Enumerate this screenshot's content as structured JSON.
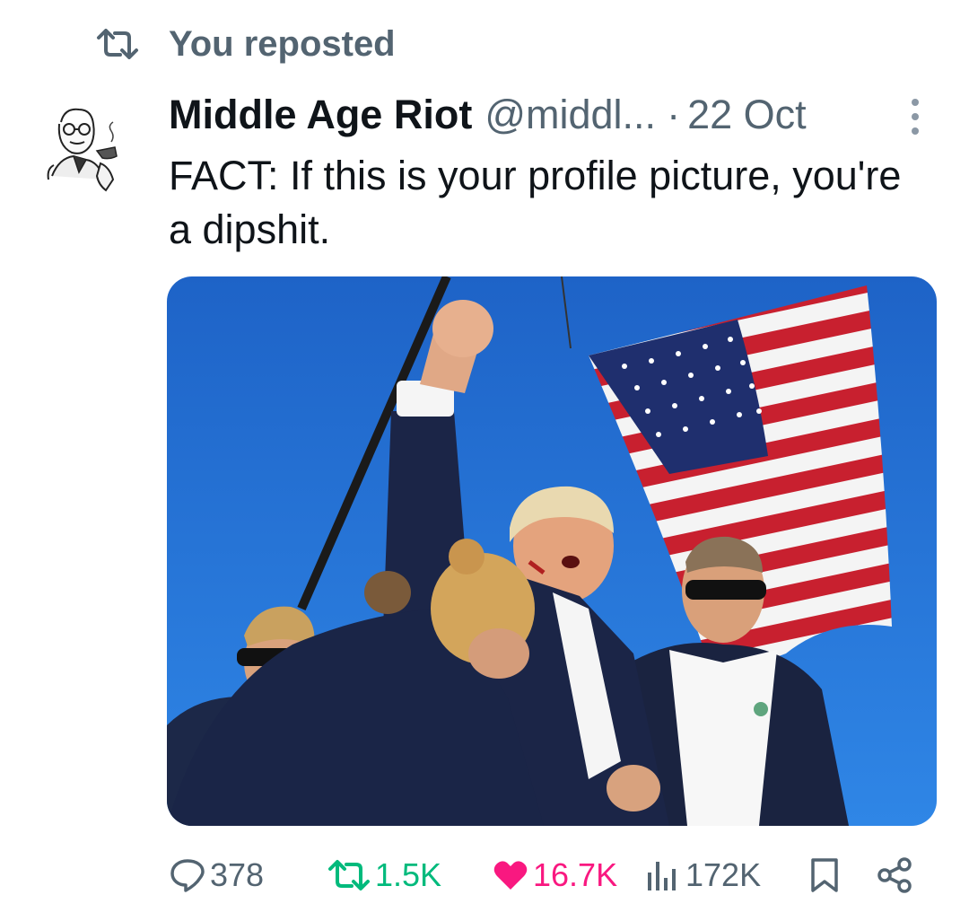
{
  "repost": {
    "text": "You reposted",
    "icon": "repost-icon"
  },
  "author": {
    "name": "Middle Age Riot",
    "handle": "@middl...",
    "separator": "·",
    "date": "22 Oct"
  },
  "tweet": {
    "text": "FACT: If this is your profile picture, you're a dipshit."
  },
  "actions": {
    "replies": "378",
    "reposts": "1.5K",
    "likes": "16.7K",
    "views": "172K"
  },
  "colors": {
    "muted": "#536471",
    "repost_active": "#00ba7c",
    "like_active": "#f91880",
    "sky": "#1b6fd6"
  }
}
